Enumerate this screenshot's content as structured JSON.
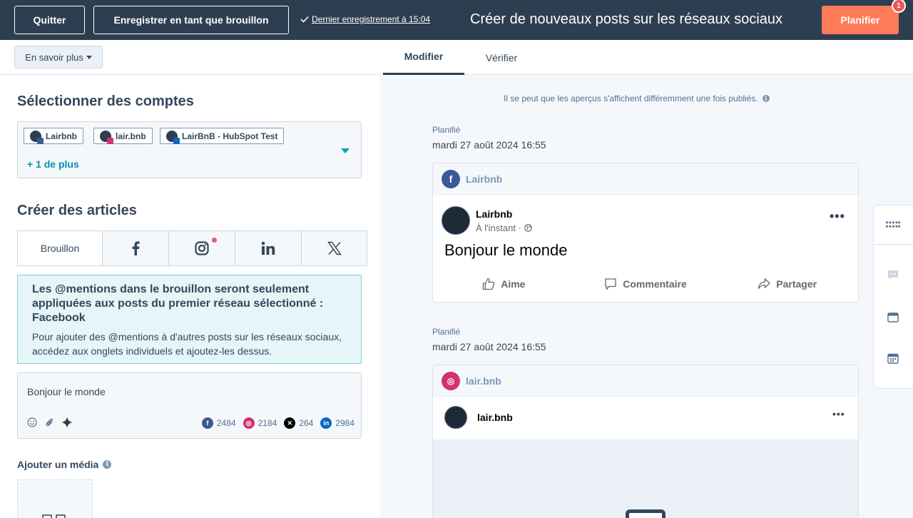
{
  "topbar": {
    "quit_label": "Quitter",
    "draft_label": "Enregistrer en tant que brouillon",
    "last_save": "Dernier enregistrement à 15:04",
    "title": "Créer de nouveaux posts sur les réseaux sociaux",
    "plan_label": "Planifier",
    "badge_count": "1"
  },
  "tabs": {
    "learn_more": "En savoir plus",
    "edit": "Modifier",
    "verify": "Vérifier"
  },
  "accounts": {
    "heading": "Sélectionner des comptes",
    "chips": [
      {
        "label": "Lairbnb",
        "network": "facebook"
      },
      {
        "label": "lair.bnb",
        "network": "instagram"
      },
      {
        "label": "LairBnB - HubSpot Test",
        "network": "linkedin"
      }
    ],
    "more": "+ 1 de plus"
  },
  "articles": {
    "heading": "Créer des articles",
    "draft_tab": "Brouillon",
    "network_tabs": [
      "facebook-icon",
      "instagram-icon",
      "linkedin-icon",
      "x-icon"
    ]
  },
  "alert": {
    "title": "Les @mentions dans le brouillon seront seulement appliquées aux posts du premier réseau sélectionné : Facebook",
    "body": "Pour ajouter des @mentions à d'autres posts sur les réseaux sociaux, accédez aux onglets individuels et ajoutez-les dessus."
  },
  "composer": {
    "text": "Bonjour le monde",
    "counts": {
      "facebook": "2484",
      "instagram": "2184",
      "x": "264",
      "linkedin": "2984"
    }
  },
  "media": {
    "label": "Ajouter un média"
  },
  "preview": {
    "note": "Il se peut que les aperçus s'affichent différemment une fois publiés.",
    "posts": [
      {
        "status": "Planifié",
        "date": "mardi 27 août 2024 16:55",
        "account": "Lairbnb",
        "name": "Lairbnb",
        "meta": "À l'instant ·",
        "text": "Bonjour le monde",
        "actions": [
          "Aime",
          "Commentaire",
          "Partager"
        ]
      },
      {
        "status": "Planifié",
        "date": "mardi 27 août 2024 16:55",
        "account": "lair.bnb",
        "name": "lair.bnb"
      }
    ]
  },
  "colors": {
    "topbar": "#2d3e50",
    "accent": "#ff7a59",
    "facebook": "#3b5998",
    "instagram": "#d6316f",
    "linkedin": "#0a66c2",
    "x": "#000000",
    "link": "#0091ae"
  }
}
